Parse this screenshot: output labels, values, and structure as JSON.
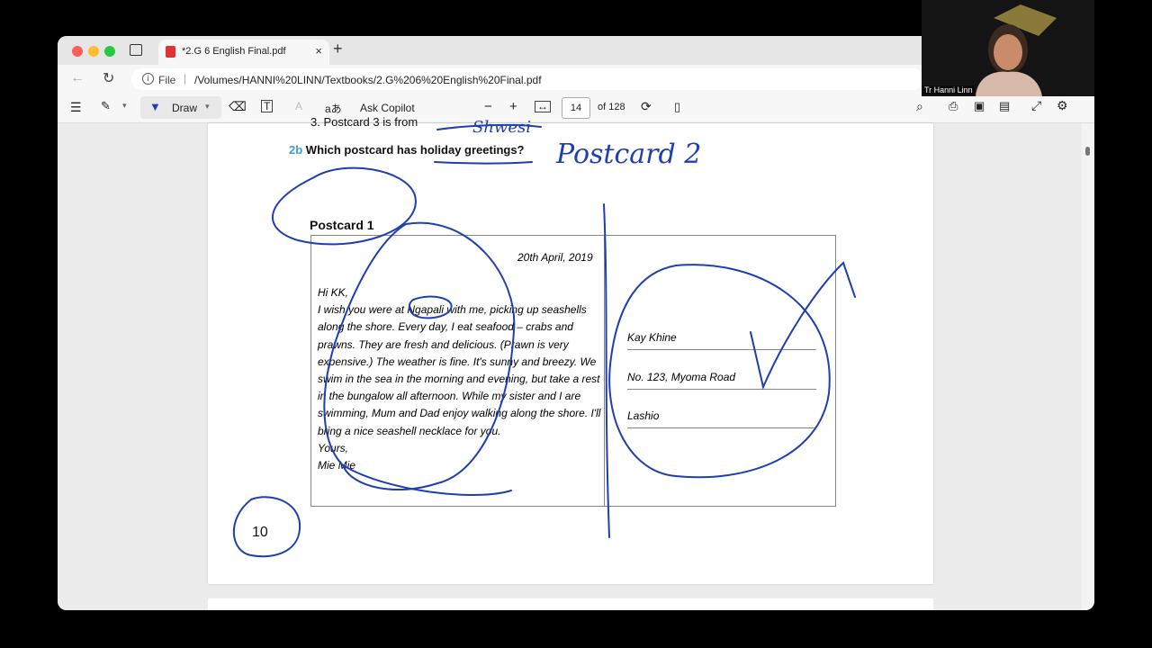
{
  "browser": {
    "tab_title": "*2.G 6 English Final.pdf",
    "tab_close": "×",
    "new_tab": "+",
    "url_scheme": "File",
    "url": "/Volumes/HANNI%20LINN/Textbooks/2.G%206%20English%20Final.pdf"
  },
  "toolbar": {
    "draw_label": "Draw",
    "ask_copilot": "Ask Copilot",
    "zoom_out": "−",
    "zoom_in": "+",
    "page_current": "14",
    "page_total": "of 128",
    "read_aloud_icon": "aあ"
  },
  "page": {
    "q3_text": "3.   Postcard 3 is from",
    "q2b_number": "2b",
    "q2b_text": "Which postcard has holiday greetings?",
    "postcard_label": "Postcard 1",
    "date": "20th April, 2019",
    "greeting": "Hi KK,",
    "body": "I wish you were at Ngapali with me, picking up seashells along the shore. Every day, I eat seafood – crabs and prawns. They are fresh and delicious. (Prawn is very expensive.) The weather is fine. It's sunny and breezy. We swim in the sea in the morning and evening, but take a rest in the bungalow all afternoon. While my sister and I are swimming, Mum and Dad enjoy walking along the shore. I'll bring a nice seashell necklace for you.",
    "closing": "Yours,",
    "signature": "Mie Mie",
    "address_name": "Kay Khine",
    "address_street": "No. 123, Myoma Road",
    "address_city": "Lashio",
    "page_number": "10"
  },
  "annotations": {
    "handwritten_answer": "Postcard 2",
    "handwritten_q3": "Shwesi"
  },
  "camera": {
    "name": "Tr Hanni Linn"
  },
  "colors": {
    "ink": "#1f3fb0",
    "accent": "#3a9dd8"
  }
}
